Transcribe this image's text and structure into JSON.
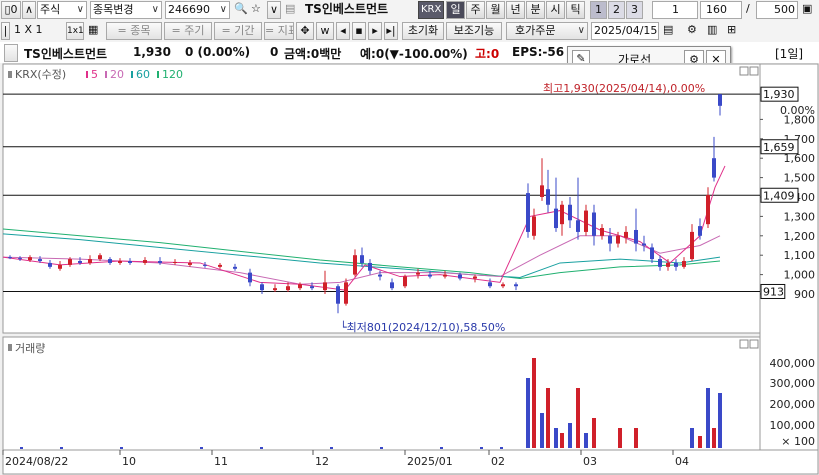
{
  "toolbar1": {
    "market": "주식",
    "change_stock": "종목변경",
    "code": "246690",
    "name": "TS인베스트먼트",
    "exchange": "KRX",
    "periods": [
      "일",
      "주",
      "월",
      "년",
      "분",
      "시",
      "틱"
    ],
    "active_period": "일",
    "pages": [
      "1",
      "2",
      "3"
    ],
    "interval": "1",
    "count": "160",
    "separator": "/",
    "total": "500"
  },
  "toolbar2": {
    "items": [
      "1 X 1",
      "1 X 1",
      "= 종목",
      "= 주기",
      "= 기간",
      "= 지표"
    ],
    "reset": "초기화",
    "aux": "보조기능",
    "order": "호가주문",
    "date": "2025/04/15"
  },
  "infobar": {
    "name": "TS인베스트먼트",
    "price": "1,930",
    "change": "0 (0.00%)",
    "volume": "0",
    "amount": "금액:0백만",
    "expected": "예:0(▼-100.00%)",
    "high_label": "고:0",
    "eps": "EPS:-56",
    "period_label": "[1일]"
  },
  "popup": {
    "title": "가로선"
  },
  "colors": {
    "up": "#d0202a",
    "down": "#3a49c8",
    "ma5": "#e0308a",
    "ma20": "#c86ab4",
    "ma60": "#18a0a0",
    "ma120": "#20b070"
  },
  "chart_data": {
    "type": "candlestick",
    "legend": {
      "title": "KRX(수정)",
      "items": [
        "5",
        "20",
        "60",
        "120"
      ]
    },
    "y_ticks": [
      900,
      1000,
      1100,
      1200,
      1300,
      1400,
      1500,
      1600,
      1700,
      1800
    ],
    "x_labels": [
      "2024/08/22",
      "10",
      "11",
      "12",
      "2025/01",
      "02",
      "03",
      "04"
    ],
    "max_annotation": "최고1,930(2025/04/14),0.00%",
    "min_annotation": "최저801(2024/12/10),58.50%",
    "hlines": [
      {
        "value": 1930,
        "label": "1,930"
      },
      {
        "value": 1659,
        "label": "1,659"
      },
      {
        "value": 1409,
        "label": "1,409"
      },
      {
        "value": 913,
        "label": "913"
      }
    ],
    "pct_label": "0.00%",
    "volume_label": "거래량",
    "volume_ticks": [
      "400,000",
      "300,000",
      "200,000",
      "100,000",
      "× 100"
    ]
  }
}
